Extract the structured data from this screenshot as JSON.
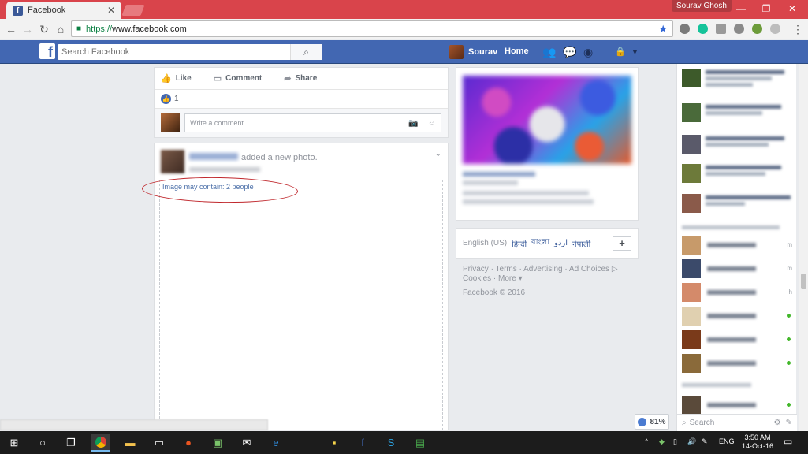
{
  "browser": {
    "tab_title": "Facebook",
    "tab_favicon": "f",
    "tab_close": "✕",
    "profile_name": "Sourav Ghosh",
    "minimize": "—",
    "restore": "❐",
    "close": "✕",
    "url_scheme": "https://",
    "url_host": "www.facebook.com",
    "accent": "#d9444b"
  },
  "fb": {
    "search_placeholder": "Search Facebook",
    "profile_name": "Sourav",
    "home": "Home",
    "brand_color": "#4267b2"
  },
  "post_actions": {
    "like": "Like",
    "comment": "Comment",
    "share": "Share",
    "like_count": "1",
    "comment_placeholder": "Write a comment..."
  },
  "post": {
    "action_text": "added a new photo.",
    "image_alt": "Image may contain: 2 people"
  },
  "languages": {
    "current": "English (US)",
    "alternates": [
      "हिन्दी",
      "বাংলা",
      "اردو",
      "नेपाली"
    ],
    "add": "+"
  },
  "footer": {
    "links": [
      "Privacy",
      "Terms",
      "Advertising",
      "Ad Choices",
      "Cookies",
      "More"
    ],
    "copyright": "Facebook © 2016"
  },
  "chat": {
    "search_placeholder": "Search"
  },
  "zoom_badge": "81%",
  "taskbar": {
    "lang": "ENG",
    "time": "3:50 AM",
    "date": "14-Oct-16"
  }
}
